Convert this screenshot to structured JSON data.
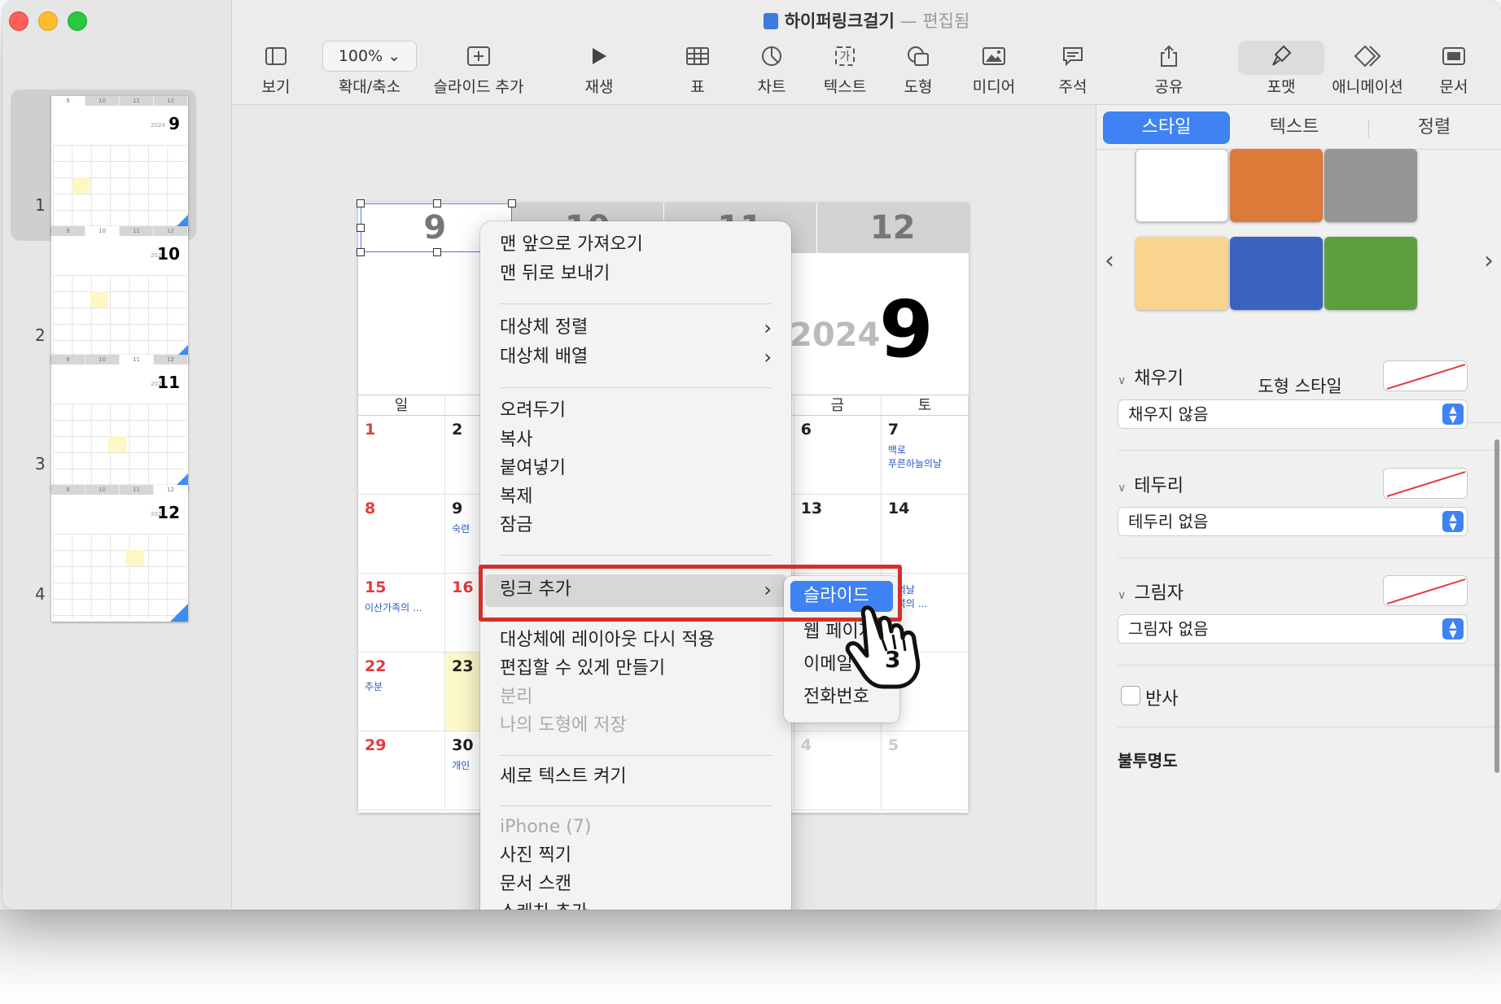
{
  "window": {
    "title": "하이퍼링크걸기",
    "title_sep": "—",
    "title_status": "편집됨"
  },
  "toolbar": {
    "view": "보기",
    "zoom_value": "100%",
    "zoom_chevron": "⌄",
    "zoom": "확대/축소",
    "add_slide": "슬라이드 추가",
    "play": "재생",
    "table": "표",
    "chart": "차트",
    "text": "텍스트",
    "text_icon_glyph": "가",
    "shape": "도형",
    "media": "미디어",
    "comment": "주석",
    "share": "공유",
    "format": "포맷",
    "animate": "애니메이션",
    "document": "문서"
  },
  "slides": [
    {
      "num": "1",
      "month": "9",
      "year": "2024"
    },
    {
      "num": "2",
      "month": "10",
      "year": "2024"
    },
    {
      "num": "3",
      "month": "11",
      "year": "2024"
    },
    {
      "num": "4",
      "month": "12",
      "year": "2024"
    }
  ],
  "thumb_tabs": [
    "9",
    "10",
    "11",
    "12"
  ],
  "slide": {
    "tabs": [
      "9",
      "10",
      "11",
      "12"
    ],
    "year": "2024",
    "month": "9",
    "weekdays": [
      "일",
      "월",
      "화",
      "수",
      "목",
      "금",
      "토"
    ],
    "rows": [
      [
        {
          "d": "1",
          "c": "red"
        },
        {
          "d": "2"
        },
        {
          "d": ""
        },
        {
          "d": ""
        },
        {
          "d": ""
        },
        {
          "d": "6"
        },
        {
          "d": "7",
          "ev": "백로\n푸른하늘의날"
        }
      ],
      [
        {
          "d": "8",
          "c": "red"
        },
        {
          "d": "9",
          "ev": "숙련"
        },
        {
          "d": ""
        },
        {
          "d": ""
        },
        {
          "d": ""
        },
        {
          "d": "13"
        },
        {
          "d": "14"
        }
      ],
      [
        {
          "d": "15",
          "c": "red",
          "ev": "이산가족의 ..."
        },
        {
          "d": "16",
          "c": "red"
        },
        {
          "d": ""
        },
        {
          "d": ""
        },
        {
          "d": ""
        },
        {
          "d": ""
        },
        {
          "d": "",
          "ev": "인의날\n극복의 ..."
        }
      ],
      [
        {
          "d": "22",
          "c": "red",
          "ev": "추분"
        },
        {
          "d": "23",
          "y": true
        },
        {
          "d": ""
        },
        {
          "d": ""
        },
        {
          "d": ""
        },
        {
          "d": ""
        },
        {
          "d": ""
        }
      ],
      [
        {
          "d": "29",
          "c": "red"
        },
        {
          "d": "30",
          "ev": "개인"
        },
        {
          "d": ""
        },
        {
          "d": ""
        },
        {
          "d": ""
        },
        {
          "d": "4",
          "c": "grey"
        },
        {
          "d": "5",
          "c": "grey"
        }
      ]
    ]
  },
  "context_menu": {
    "bring_front": "맨 앞으로 가져오기",
    "send_back": "맨 뒤로 보내기",
    "align": "대상체 정렬",
    "distribute": "대상체 배열",
    "cut": "오려두기",
    "copy": "복사",
    "paste": "붙여넣기",
    "duplicate": "복제",
    "lock": "잠금",
    "add_link": "링크 추가",
    "reapply_layout": "대상체에 레이아웃 다시 적용",
    "make_editable": "편집할 수 있게 만들기",
    "unlink": "분리",
    "save_shape": "나의 도형에 저장",
    "vertical_text": "세로 텍스트 켜기",
    "iphone": "iPhone (7)",
    "take_photo": "사진 찍기",
    "scan": "문서 스캔",
    "sketch": "스케치 추가"
  },
  "submenu": {
    "slide": "슬라이드",
    "web": "웹 페이지",
    "email": "이메일",
    "phone": "전화번호"
  },
  "cursor_step": "3",
  "panel": {
    "tabs": [
      "스타일",
      "텍스트",
      "정렬"
    ],
    "swatch_colors": [
      "#ffffff",
      "#dc7a3a",
      "#959595",
      "#f9d48e",
      "#3a63c0",
      "#5c9f3f"
    ],
    "style_title": "도형 스타일",
    "fill_label": "채우기",
    "fill_value": "채우지 않음",
    "border_label": "테두리",
    "border_value": "테두리 없음",
    "shadow_label": "그림자",
    "shadow_value": "그림자 없음",
    "reflection_label": "반사",
    "opacity_label": "불투명도"
  },
  "colors": {
    "accent": "#3f82f3",
    "highlight_frame": "#d4302b",
    "sunday": "#e23b3b",
    "event": "#2b58c8"
  }
}
